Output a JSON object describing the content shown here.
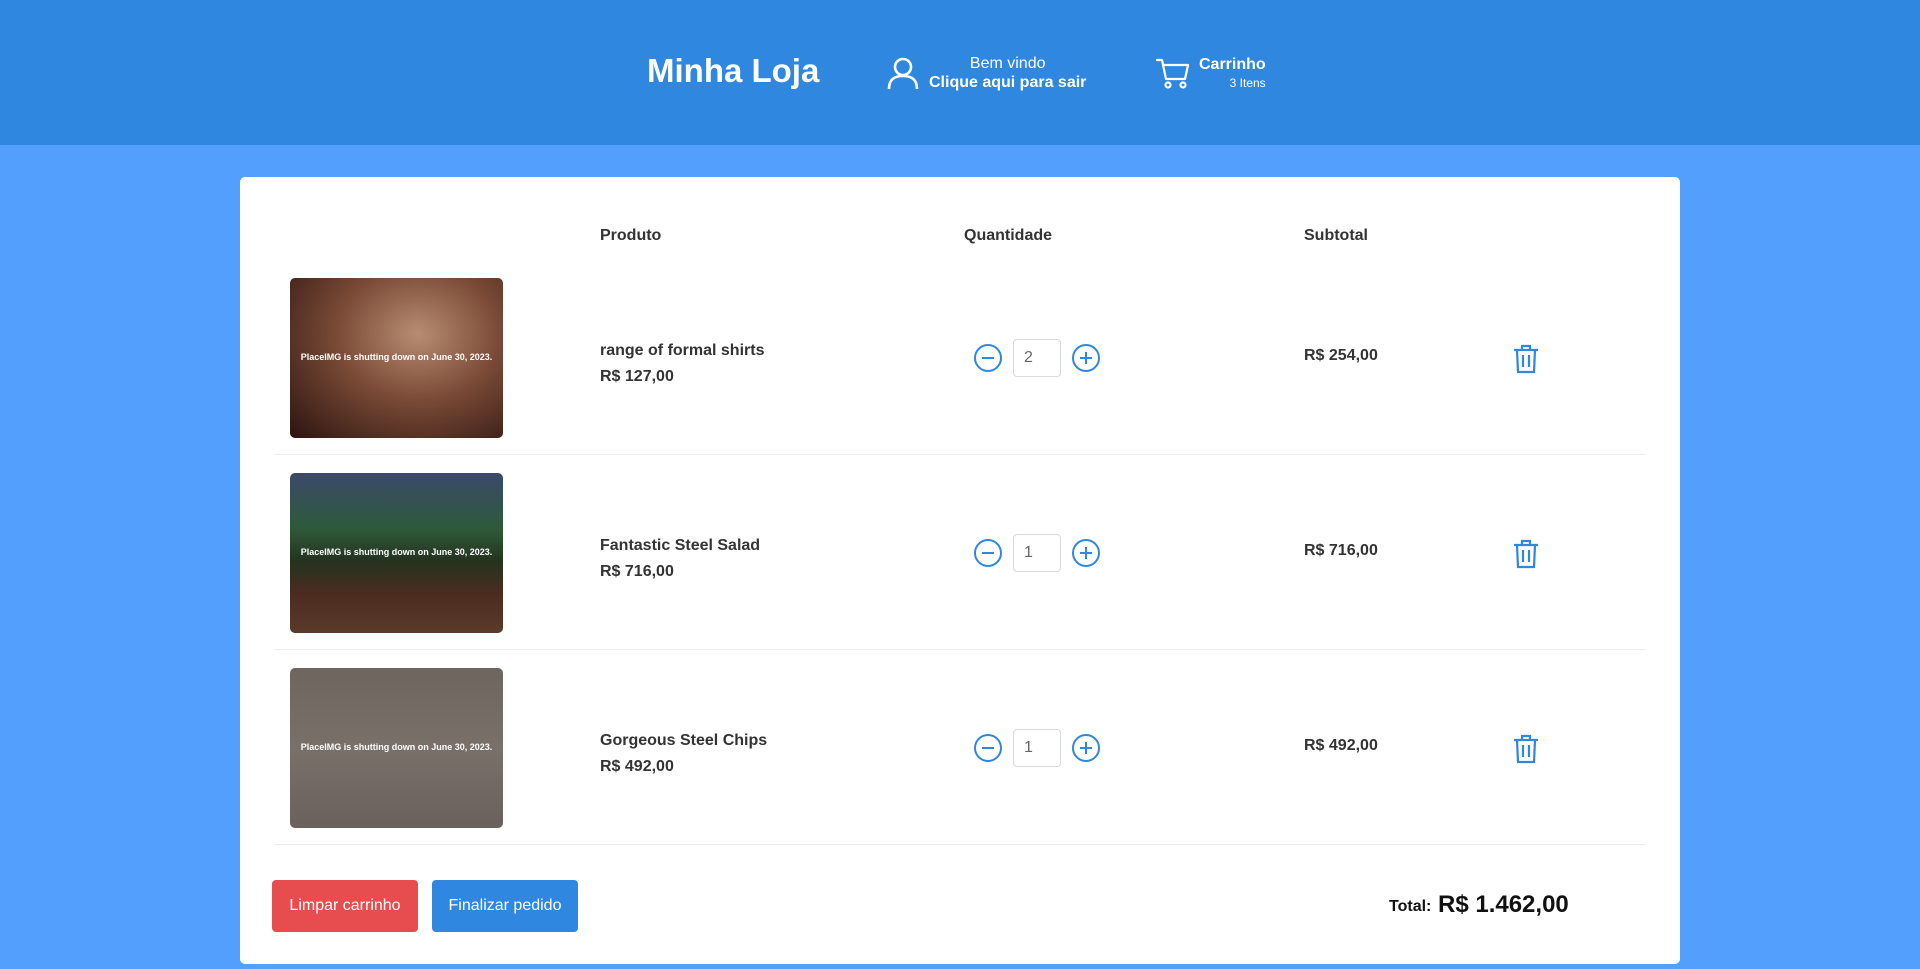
{
  "header": {
    "brand": "Minha Loja",
    "user": {
      "greeting": "Bem vindo",
      "action": "Clique aqui para sair",
      "icon": "user-icon"
    },
    "cart": {
      "label": "Carrinho",
      "count": "3 Itens",
      "icon": "cart-icon"
    }
  },
  "table": {
    "headers": {
      "product": "Produto",
      "quantity": "Quantidade",
      "subtotal": "Subtotal"
    },
    "rows": [
      {
        "image_caption": "PlaceIMG is shutting down on June 30, 2023.",
        "name": "range of formal shirts",
        "price": "R$ 127,00",
        "quantity": "2",
        "subtotal": "R$ 254,00"
      },
      {
        "image_caption": "PlaceIMG is shutting down on June 30, 2023.",
        "name": "Fantastic Steel Salad",
        "price": "R$ 716,00",
        "quantity": "1",
        "subtotal": "R$ 716,00"
      },
      {
        "image_caption": "PlaceIMG is shutting down on June 30, 2023.",
        "name": "Gorgeous Steel Chips",
        "price": "R$ 492,00",
        "quantity": "1",
        "subtotal": "R$ 492,00"
      }
    ]
  },
  "footer": {
    "clear_label": "Limpar carrinho",
    "finish_label": "Finalizar pedido",
    "total_label": "Total:",
    "total_value": "R$ 1.462,00"
  },
  "colors": {
    "header_bg": "#2f87e0",
    "page_bg": "#529ffd",
    "accent": "#2f87e0",
    "danger": "#e74c4f"
  }
}
